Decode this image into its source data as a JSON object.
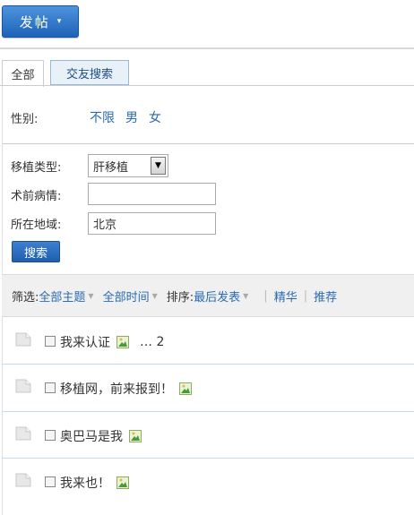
{
  "post_button": {
    "label": "发帖",
    "caret": "▾"
  },
  "tabs": [
    {
      "label": "全部"
    },
    {
      "label": "交友搜索"
    }
  ],
  "gender": {
    "label": "性别:",
    "options": [
      "不限",
      "男",
      "女"
    ]
  },
  "form": {
    "transplant_type_label": "移植类型:",
    "transplant_type_value": "肝移植",
    "preop_label": "术前病情:",
    "preop_value": "",
    "region_label": "所在地域:",
    "region_value": "北京",
    "search_label": "搜索"
  },
  "filter": {
    "label": "筛选:",
    "topics": "全部主题",
    "time": "全部时间",
    "sort_label": "排序:",
    "sort_value": "最后发表",
    "digest": "精华",
    "recommend": "推荐",
    "separator": "|"
  },
  "threads": [
    {
      "title": "我来认证",
      "pages": "… 2"
    },
    {
      "title": "移植网，前来报到！"
    },
    {
      "title": "奥巴马是我"
    },
    {
      "title": "我来也！"
    }
  ],
  "colors": {
    "accent": "#2a6bb0",
    "button": "#1f63b8"
  }
}
